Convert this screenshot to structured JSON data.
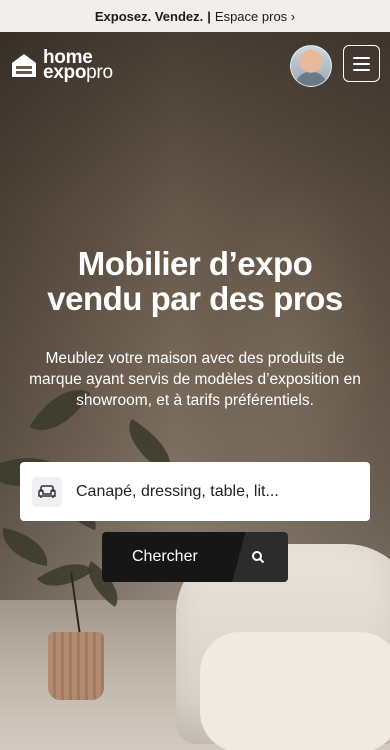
{
  "banner": {
    "bold": "Exposez. Vendez.",
    "separator": "|",
    "link": "Espace pros ›"
  },
  "logo": {
    "line1": "home",
    "line2": "expo",
    "line3": "pro"
  },
  "hero": {
    "title_line1": "Mobilier d’expo",
    "title_line2": "vendu par des pros",
    "subtitle": "Meublez votre maison avec des produits de marque ayant servis de modèles d’exposition en showroom, et à tarifs préférentiels."
  },
  "search": {
    "placeholder": "Canapé, dressing, table, lit...",
    "value": "",
    "button_label": "Chercher"
  },
  "icons": {
    "logo": "house-icon",
    "search": "search-icon",
    "sofa": "sofa-icon",
    "menu": "menu-icon"
  }
}
